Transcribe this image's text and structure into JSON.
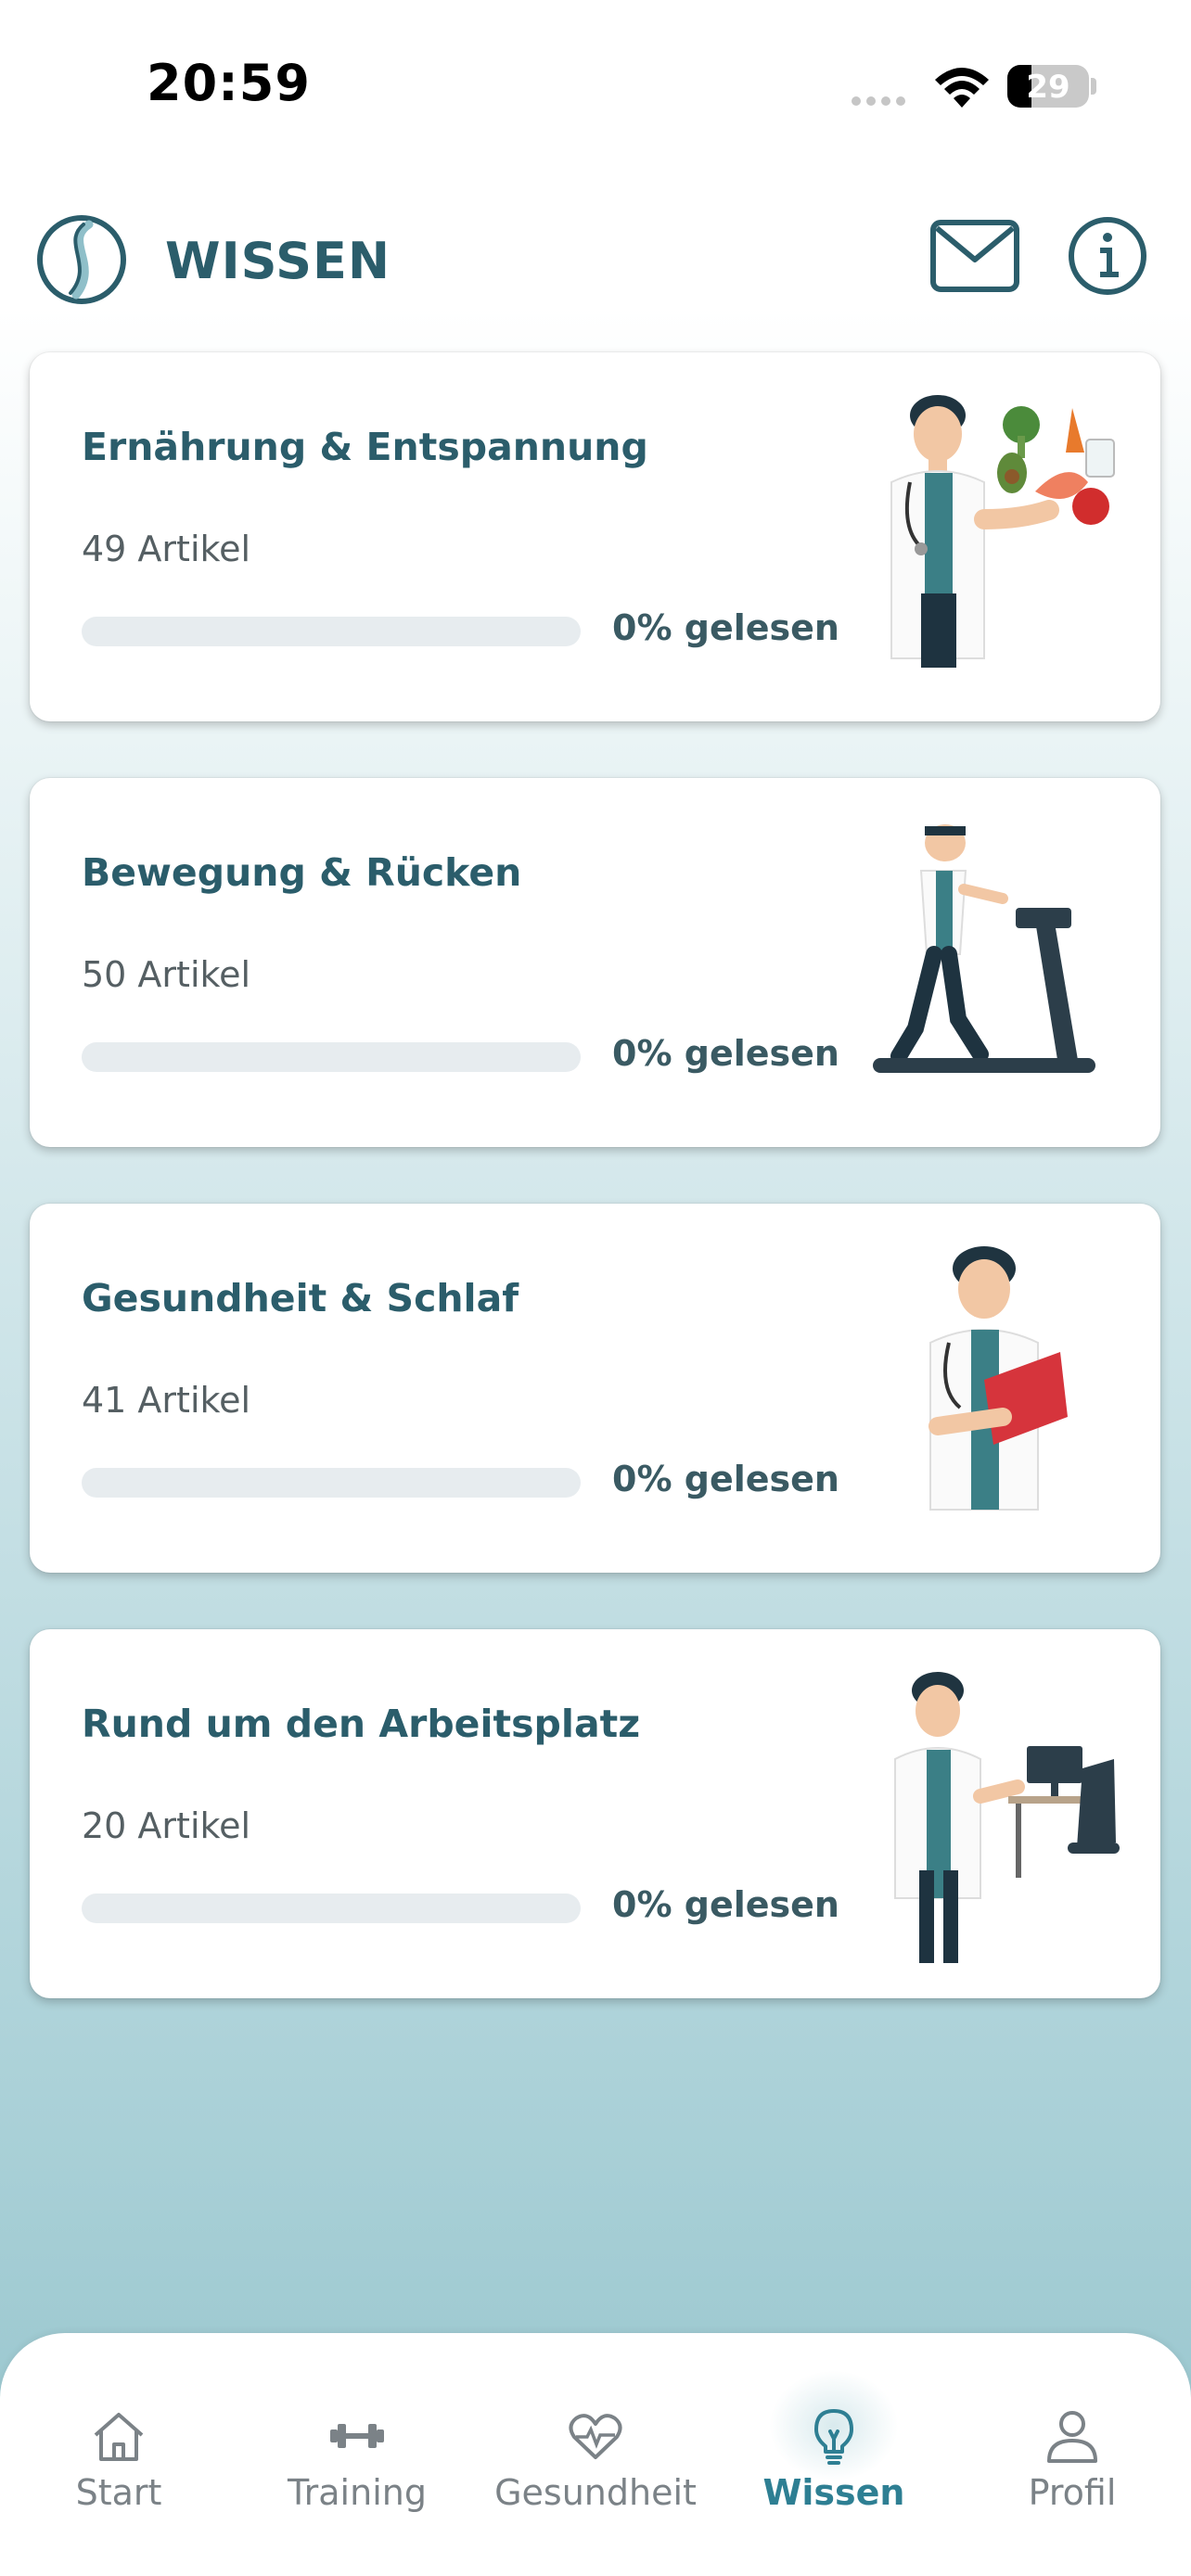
{
  "status_bar": {
    "time": "20:59",
    "battery": "29"
  },
  "header": {
    "title": "WISSEN",
    "mail_icon": "envelope-icon",
    "info_icon": "info-icon",
    "logo_icon": "spine-logo-icon"
  },
  "cards": [
    {
      "title": "Ernährung & Entspannung",
      "count": "49 Artikel",
      "progress_label": "0% gelesen",
      "progress": 0,
      "illustration": "doctor-food-illustration"
    },
    {
      "title": "Bewegung & Rücken",
      "count": "50 Artikel",
      "progress_label": "0% gelesen",
      "progress": 0,
      "illustration": "doctor-treadmill-illustration"
    },
    {
      "title": "Gesundheit & Schlaf",
      "count": "41 Artikel",
      "progress_label": "0% gelesen",
      "progress": 0,
      "illustration": "doctor-book-illustration"
    },
    {
      "title": "Rund um den Arbeitsplatz",
      "count": "20 Artikel",
      "progress_label": "0% gelesen",
      "progress": 0,
      "illustration": "doctor-desk-illustration"
    }
  ],
  "nav": {
    "items": [
      {
        "label": "Start",
        "icon": "home-icon"
      },
      {
        "label": "Training",
        "icon": "dumbbell-icon"
      },
      {
        "label": "Gesundheit",
        "icon": "heart-pulse-icon"
      },
      {
        "label": "Wissen",
        "icon": "lightbulb-icon",
        "active": true
      },
      {
        "label": "Profil",
        "icon": "user-icon"
      }
    ]
  },
  "colors": {
    "primary": "#2b5d6b",
    "accent": "#2e7f93",
    "track": "#e7ecef"
  }
}
